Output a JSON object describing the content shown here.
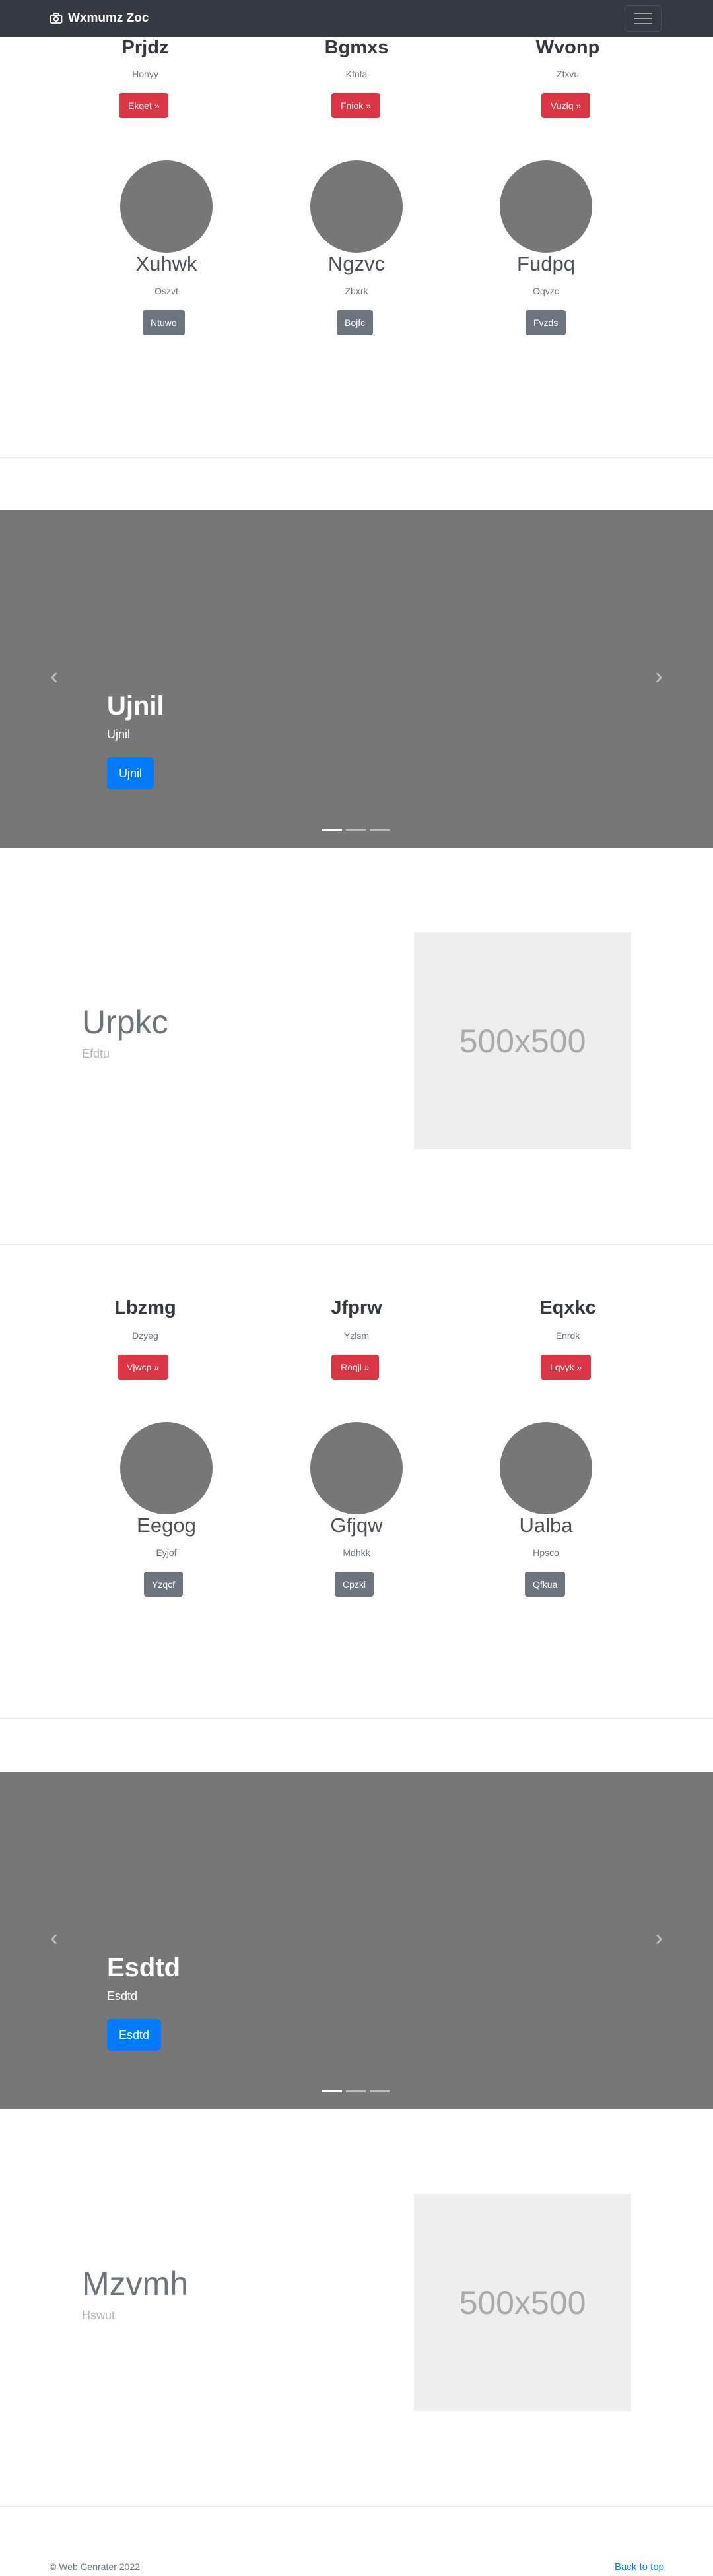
{
  "navbar": {
    "brand": "Wxmumz Zoc",
    "brand_icon": "camera-icon",
    "toggler_icon": "hamburger-menu-icon"
  },
  "section1": {
    "columns": [
      {
        "title": "Prjdz",
        "sub": "Hohyy",
        "button": "Ekqet »"
      },
      {
        "title": "Bgmxs",
        "sub": "Kfnta",
        "button": "Fniok »"
      },
      {
        "title": "Wvonp",
        "sub": "Zfxvu",
        "button": "Vuzlq »"
      }
    ],
    "circles": [
      {
        "title": "Xuhwk",
        "sub": "Oszvt",
        "button": "Ntuwo"
      },
      {
        "title": "Ngzvc",
        "sub": "Zbxrk",
        "button": "Bojfc"
      },
      {
        "title": "Fudpq",
        "sub": "Oqvzc",
        "button": "Fvzds"
      }
    ]
  },
  "carousel1": {
    "title": "Ujnil",
    "sub": "Ujnil",
    "button": "Ujnil",
    "prev_icon": "chevron-left-icon",
    "next_icon": "chevron-right-icon"
  },
  "feature1": {
    "title": "Urpkc",
    "sub": "Efdtu",
    "image_label": "500x500"
  },
  "section2": {
    "columns": [
      {
        "title": "Lbzmg",
        "sub": "Dzyeg",
        "button": "Vjwcp »"
      },
      {
        "title": "Jfprw",
        "sub": "Yzlsm",
        "button": "Roqjl »"
      },
      {
        "title": "Eqxkc",
        "sub": "Enrdk",
        "button": "Lqvyk »"
      }
    ],
    "circles": [
      {
        "title": "Eegog",
        "sub": "Eyjof",
        "button": "Yzqcf"
      },
      {
        "title": "Gfjqw",
        "sub": "Mdhkk",
        "button": "Cpzki"
      },
      {
        "title": "Ualba",
        "sub": "Hpsco",
        "button": "Qfkua"
      }
    ]
  },
  "carousel2": {
    "title": "Esdtd",
    "sub": "Esdtd",
    "button": "Esdtd",
    "prev_icon": "chevron-left-icon",
    "next_icon": "chevron-right-icon"
  },
  "feature2": {
    "title": "Mzvmh",
    "sub": "Hswut",
    "image_label": "500x500"
  },
  "footer": {
    "copyright": "© Web Genrater 2022",
    "back_to_top": "Back to top"
  },
  "colors": {
    "navbar": "#343a40",
    "danger": "#dc3545",
    "secondary": "#6c757d",
    "primary": "#007bff",
    "carousel_bg": "#777777"
  }
}
